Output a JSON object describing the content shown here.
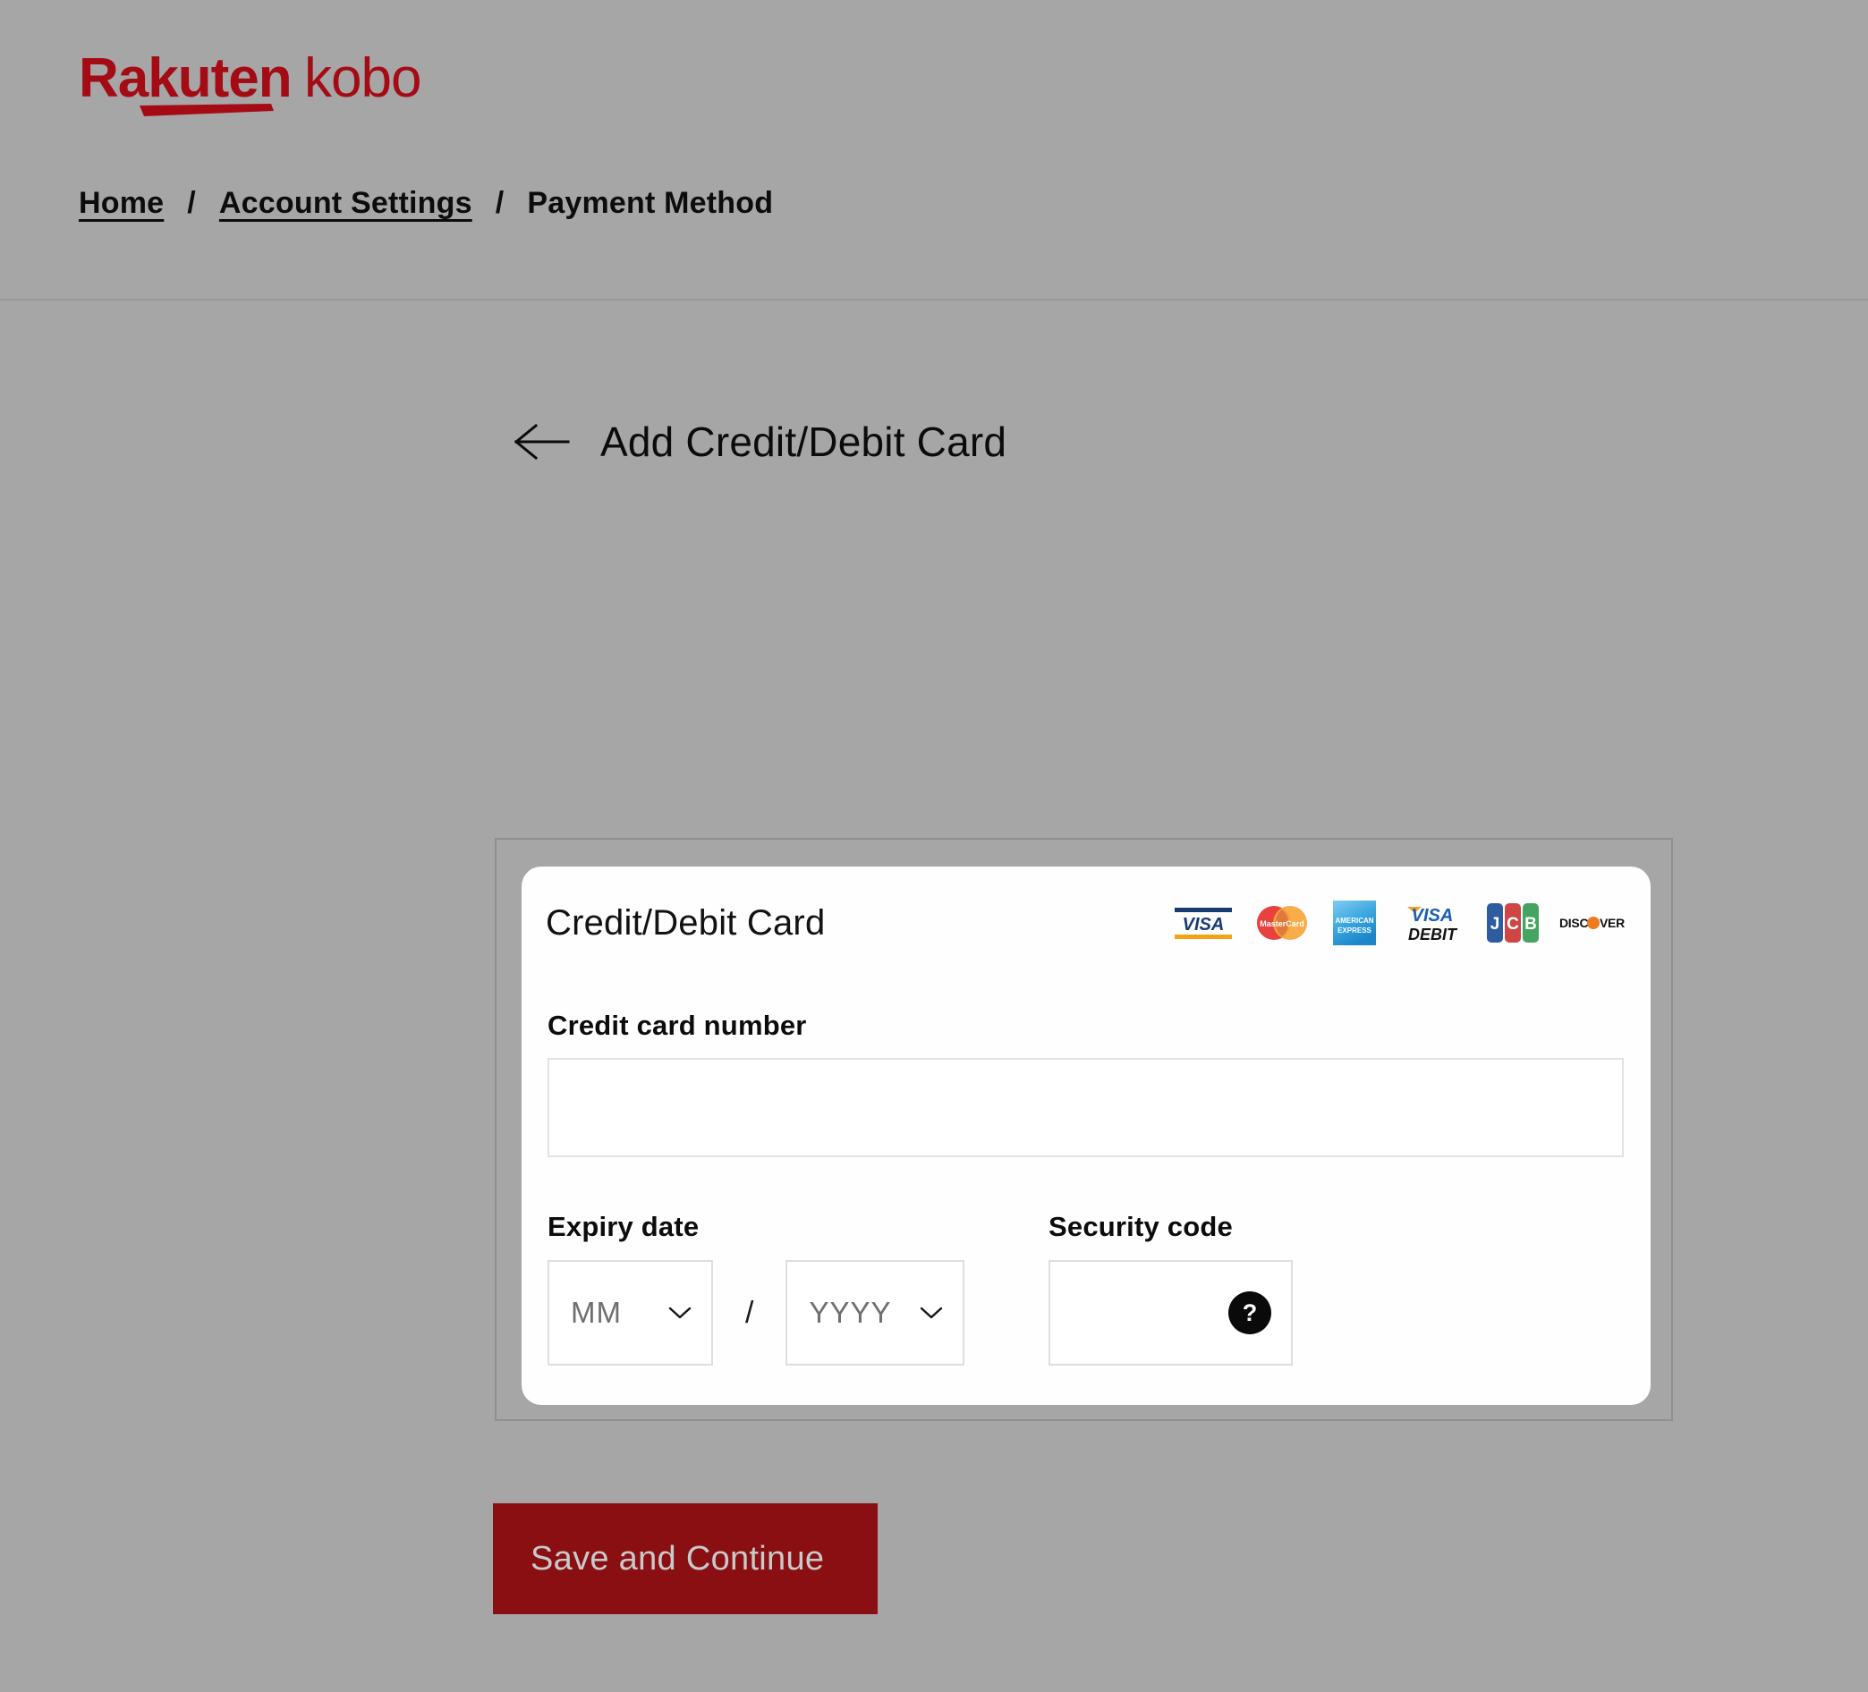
{
  "brand": {
    "logo_text": "Rakuten kobo",
    "logo_color": "#a50b14"
  },
  "breadcrumb": {
    "items": [
      {
        "label": "Home",
        "is_link": true
      },
      {
        "label": "Account Settings",
        "is_link": true
      },
      {
        "label": "Payment Method",
        "is_link": false
      }
    ],
    "separator": "/"
  },
  "page": {
    "back_icon": "arrow-left-icon",
    "title": "Add Credit/Debit Card"
  },
  "card_panel": {
    "header": "Credit/Debit Card",
    "accepted_cards": [
      {
        "name": "visa",
        "label": "VISA"
      },
      {
        "name": "mastercard",
        "label": "MasterCard"
      },
      {
        "name": "american-express",
        "label": "AMERICAN EXPRESS"
      },
      {
        "name": "visa-debit",
        "label": "VISA DEBIT"
      },
      {
        "name": "jcb",
        "label": "JCB"
      },
      {
        "name": "discover",
        "label": "DISCOVER"
      }
    ],
    "card_number": {
      "label": "Credit card number",
      "value": "",
      "placeholder": ""
    },
    "expiry": {
      "label": "Expiry date",
      "month_value": "MM",
      "year_value": "YYYY",
      "separator": "/",
      "chevron_icon": "chevron-down-icon"
    },
    "security_code": {
      "label": "Security code",
      "value": "",
      "placeholder": "",
      "help_icon": "question-mark-icon",
      "help_glyph": "?"
    }
  },
  "actions": {
    "save_label": "Save and Continue"
  },
  "colors": {
    "page_background": "#a6a6a6",
    "brand_red": "#a50b14",
    "button_red": "#8a0f13",
    "card_white": "#fefefe",
    "input_border": "#e2e2e2"
  }
}
